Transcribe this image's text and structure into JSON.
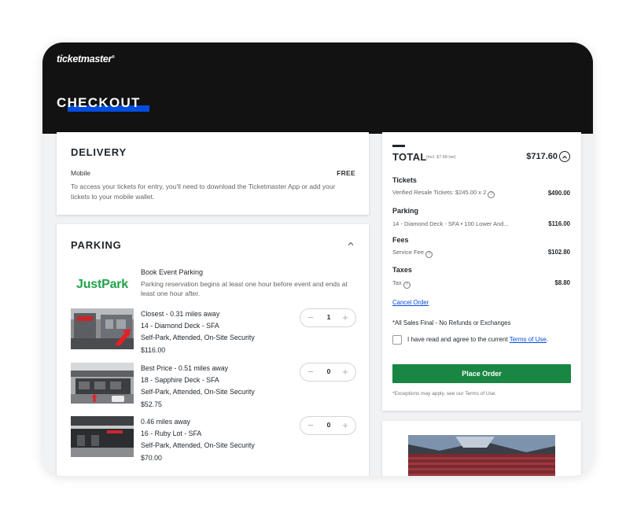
{
  "header": {
    "logo": "ticketmaster",
    "logo_mark": "®",
    "title": "CHECKOUT"
  },
  "delivery": {
    "title": "DELIVERY",
    "method": "Mobile",
    "price": "FREE",
    "description": "To access your tickets for entry, you'll need to download the Ticketmaster App or add your tickets to your mobile wallet."
  },
  "parking": {
    "title": "PARKING",
    "provider": "JustPark",
    "book_title": "Book Event Parking",
    "book_desc": "Parking reservation begins at least one hour before event and ends at least one hour after.",
    "lots": [
      {
        "distance": "Closest - 0.31 miles away",
        "name": "14 - Diamond Deck - SFA",
        "features": "Self-Park, Attended, On-Site Security",
        "price": "$116.00",
        "quantity": "1"
      },
      {
        "distance": "Best Price - 0.51 miles away",
        "name": "18 - Sapphire Deck - SFA",
        "features": "Self-Park, Attended, On-Site Security",
        "price": "$52.75",
        "quantity": "0"
      },
      {
        "distance": "0.46 miles away",
        "name": "16 - Ruby Lot - SFA",
        "features": "Self-Park, Attended, On-Site Security",
        "price": "$70.00",
        "quantity": "0"
      }
    ]
  },
  "summary": {
    "title": "TOTAL",
    "tax_note": "(incl. $7.68 tax)",
    "total": "$717.60",
    "tickets": {
      "label": "Tickets",
      "desc": "Verified Resale Tickets: $245.00 x 2",
      "amount": "$490.00"
    },
    "parking": {
      "label": "Parking",
      "desc": "14 - Diamond Deck - SFA • 100 Lower And...",
      "amount": "$116.00"
    },
    "fees": {
      "label": "Fees",
      "desc": "Service Fee",
      "amount": "$102.80"
    },
    "taxes": {
      "label": "Taxes",
      "desc": "Tax",
      "amount": "$8.80"
    },
    "cancel_order": "Cancel Order",
    "final_sale": "*All Sales Final - No Refunds or Exchanges",
    "agree_text": "I have read and agree to the current",
    "terms_link": "Terms of Use",
    "agree_end": ".",
    "place_order": "Place Order",
    "exceptions": "*Exceptions may apply, see our Terms of Use."
  },
  "colors": {
    "accent_blue": "#024ddf",
    "place_order_green": "#198643",
    "justpark_green": "#1fa34a",
    "header_black": "#121212"
  },
  "icons": {
    "collapse": "chevron-up-icon",
    "info": "info-icon",
    "decrement": "minus-icon",
    "increment": "plus-icon"
  }
}
